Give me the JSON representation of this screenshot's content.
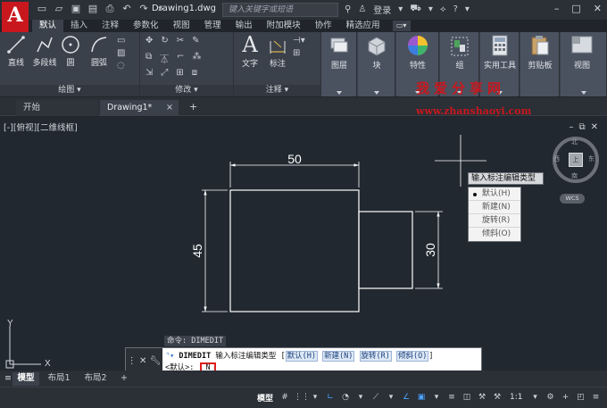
{
  "app": {
    "logo_letter": "A",
    "title": "Drawing1.dwg",
    "search_placeholder": "键入关键字或短语",
    "login_label": "登录",
    "colors": {
      "accent": "#c8181e",
      "canvas": "#212830",
      "ribbon": "#3b414b"
    }
  },
  "qat_icons": [
    "new-icon",
    "open-icon",
    "save-icon",
    "saveas-icon",
    "plot-icon",
    "undo-icon",
    "redo-icon",
    "more-icon"
  ],
  "ribbon_tabs": [
    {
      "label": "默认",
      "active": true
    },
    {
      "label": "插入"
    },
    {
      "label": "注释"
    },
    {
      "label": "参数化"
    },
    {
      "label": "视图"
    },
    {
      "label": "管理"
    },
    {
      "label": "输出"
    },
    {
      "label": "附加模块"
    },
    {
      "label": "协作"
    },
    {
      "label": "精选应用"
    }
  ],
  "ribbon": {
    "draw": {
      "title": "绘图",
      "line": "直线",
      "polyline": "多段线",
      "circle": "圆",
      "arc": "圆弧"
    },
    "modify": {
      "title": "修改"
    },
    "annotation": {
      "title": "注释",
      "text": "文字",
      "dimension": "标注"
    },
    "layers": "图层",
    "block": "块",
    "properties": "特性",
    "groups": "组",
    "utilities": "实用工具",
    "clipboard": "剪贴板",
    "view": "视图"
  },
  "watermark": {
    "cn": "我爱分享网",
    "url": "www.zhanshaoyi.com"
  },
  "doc_tabs": {
    "start": "开始",
    "drawing": "Drawing1*",
    "close": "×",
    "add": "+"
  },
  "viewport": {
    "label": "[-][俯视][二维线框]",
    "viewcube": {
      "north": "北",
      "south": "南",
      "east": "东",
      "west": "西",
      "face": "上",
      "wcs": "WCS"
    }
  },
  "dimensions": {
    "width": "50",
    "height": "45",
    "small_height": "30"
  },
  "dynamic_input": {
    "prompt": "输入标注编辑类型",
    "options": [
      {
        "label": "默认(H)",
        "selected": true
      },
      {
        "label": "新建(N)"
      },
      {
        "label": "旋转(R)"
      },
      {
        "label": "倾斜(O)"
      }
    ]
  },
  "command": {
    "history": "命令: DIMEDIT",
    "name": "DIMEDIT",
    "prompt": "输入标注编辑类型 [",
    "options": [
      "默认(H)",
      "新建(N)",
      "旋转(R)",
      "倾斜(O)"
    ],
    "prompt_end": "]",
    "default_label": "<默认>:",
    "input_value": "N"
  },
  "layout_tabs": [
    {
      "label": "模型",
      "active": true
    },
    {
      "label": "布局1"
    },
    {
      "label": "布局2"
    },
    {
      "label": "+"
    }
  ],
  "status": {
    "model": "模型",
    "scale": "1:1"
  },
  "ucs": {
    "x": "X",
    "y": "Y"
  }
}
